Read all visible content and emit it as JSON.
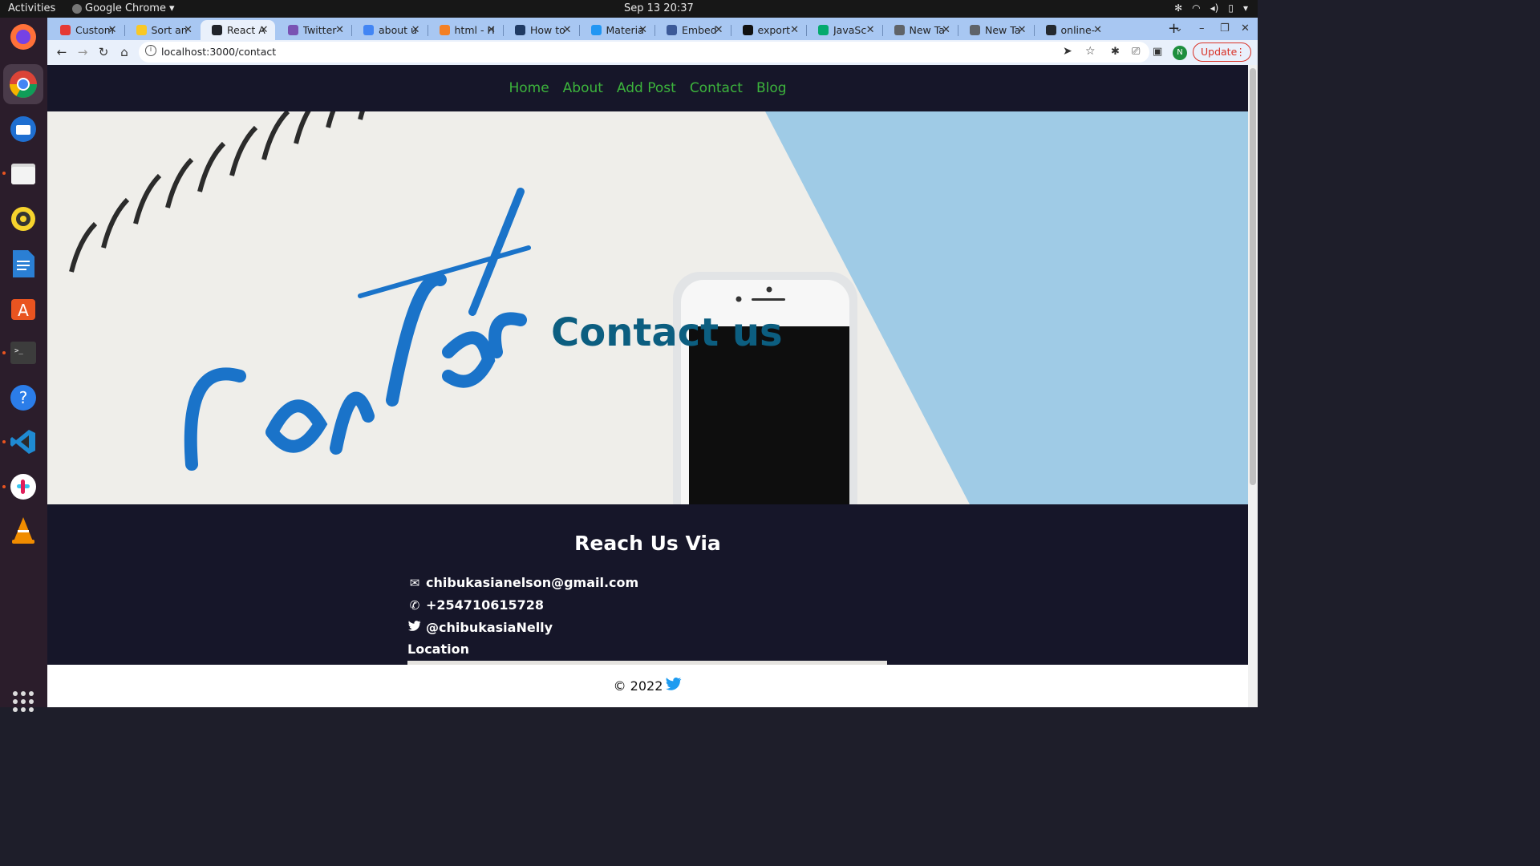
{
  "system": {
    "activities": "Activities",
    "app_name": "Google Chrome",
    "clock": "Sep 13  20:37"
  },
  "browser": {
    "tabs": [
      {
        "label": "Custom",
        "color": "#e53935"
      },
      {
        "label": "Sort an",
        "color": "#f9c825"
      },
      {
        "label": "React A",
        "color": "#20232a",
        "active": true
      },
      {
        "label": "Twitter",
        "color": "#7952b3"
      },
      {
        "label": "about u",
        "color": "#4285f4"
      },
      {
        "label": "html - H",
        "color": "#f48024"
      },
      {
        "label": "How to",
        "color": "#1f3a63"
      },
      {
        "label": "Materia",
        "color": "#2196f3"
      },
      {
        "label": "Embed",
        "color": "#3b5998"
      },
      {
        "label": "export",
        "color": "#111111"
      },
      {
        "label": "JavaSc",
        "color": "#04aa6d"
      },
      {
        "label": "New Ta",
        "color": "#5f6368"
      },
      {
        "label": "New Ta",
        "color": "#5f6368"
      },
      {
        "label": "online-",
        "color": "#24292f"
      }
    ],
    "url": "localhost:3000/contact",
    "profile_initial": "N",
    "update_label": "Update"
  },
  "site": {
    "nav": [
      "Home",
      "About",
      "Add Post",
      "Contact",
      "Blog"
    ],
    "hero_title": "Contact us",
    "reach_title": "Reach Us Via",
    "email": "chibukasianelson@gmail.com",
    "phone": "+254710615728",
    "twitter": "@chibukasiaNelly",
    "location_label": "Location",
    "copyright": "© 2022"
  },
  "colors": {
    "nav_link": "#3cb43c",
    "nav_bg": "#161629",
    "hero_title": "#0c5e80",
    "update": "#d93025"
  }
}
